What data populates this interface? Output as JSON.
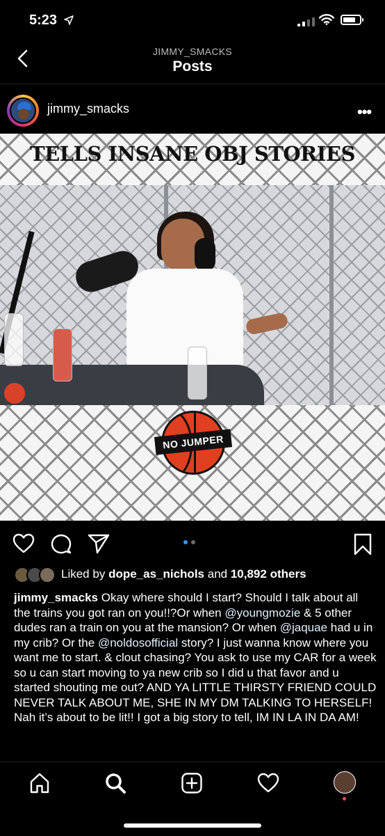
{
  "status_bar": {
    "time": "5:23"
  },
  "header": {
    "account": "JIMMY_SMACKS",
    "title": "Posts"
  },
  "post": {
    "username": "jimmy_smacks",
    "more_label": "•••",
    "media": {
      "overlay_title": "TELLS INSANE OBJ STORIES",
      "logo_text": "NO JUMPER"
    },
    "carousel": {
      "count": 2,
      "active_index": 0
    },
    "likes": {
      "prefix": "Liked by",
      "user": "dope_as_nichols",
      "middle": "and",
      "count": "10,892 others"
    },
    "caption": {
      "author": "jimmy_smacks",
      "text_1": "Okay where should I start? Should I talk about all the trains you got ran on you!!?Or when",
      "mention_1": "@youngmozie",
      "text_2": "& 5 other dudes ran a train on you at the mansion? Or when ",
      "mention_2": "@jaquae",
      "text_3": "had u in my crib? Or the",
      "mention_3": "@noldosofficial",
      "text_4": "story? I just wanna know where you want me to start. & clout chasing? You ask to use my CAR for a week so u can start moving to ya new crib so I did u that favor and u started shouting me out? AND YA LITTLE THIRSTY FRIEND COULD NEVER TALK ABOUT ME, SHE IN MY DM TALKING TO HERSELF! Nah it’s about to be lit!! I got a big story to tell, IM IN LA IN DA AM!"
    }
  },
  "tab_bar": {
    "items": [
      "home",
      "search",
      "new-post",
      "activity",
      "profile"
    ],
    "active": "search"
  },
  "colors": {
    "background": "#000000",
    "accent_blue": "#3897f0",
    "notification_red": "#ed4956"
  }
}
